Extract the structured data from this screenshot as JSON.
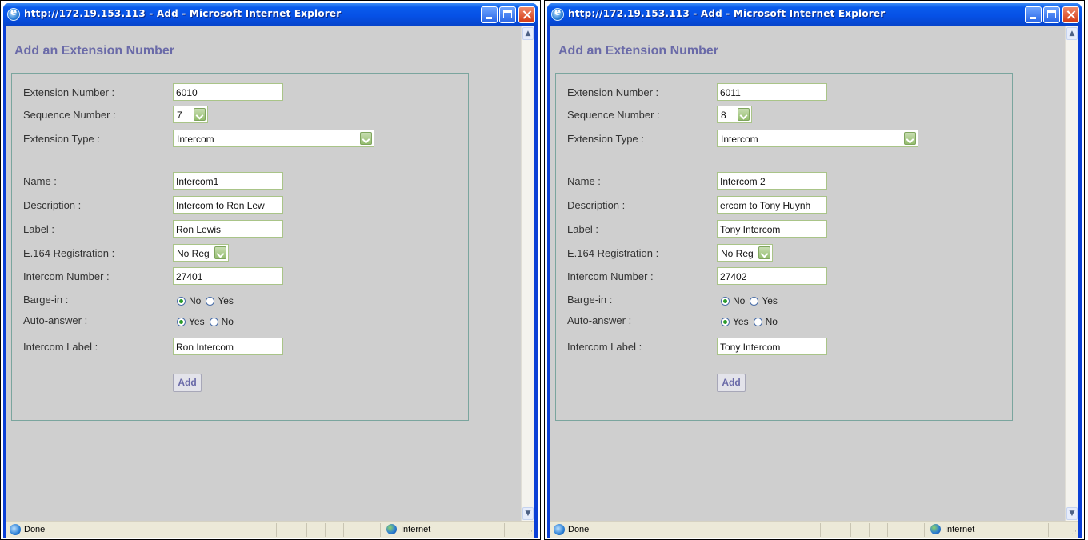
{
  "windows": [
    {
      "title": "http://172.19.153.113 - Add - Microsoft Internet Explorer",
      "page_title": "Add an Extension Number",
      "fields": {
        "extension_number": {
          "label": "Extension Number :",
          "value": "6010"
        },
        "sequence_number": {
          "label": "Sequence Number :",
          "value": "7"
        },
        "extension_type": {
          "label": "Extension Type :",
          "value": "Intercom"
        },
        "name": {
          "label": "Name :",
          "value": "Intercom1"
        },
        "description": {
          "label": "Description :",
          "value": "Intercom to Ron Lew"
        },
        "label": {
          "label": "Label :",
          "value": "Ron Lewis"
        },
        "e164_registration": {
          "label": "E.164 Registration :",
          "value": "No Reg"
        },
        "intercom_number": {
          "label": "Intercom Number :",
          "value": "27401"
        },
        "barge_in": {
          "label": "Barge-in :",
          "option1": "No",
          "option2": "Yes",
          "selected": "No"
        },
        "auto_answer": {
          "label": "Auto-answer :",
          "option1": "Yes",
          "option2": "No",
          "selected": "Yes"
        },
        "intercom_label": {
          "label": "Intercom Label :",
          "value": "Ron Intercom"
        }
      },
      "add_button": "Add",
      "status": {
        "text": "Done",
        "zone": "Internet"
      }
    },
    {
      "title": "http://172.19.153.113 - Add - Microsoft Internet Explorer",
      "page_title": "Add an Extension Number",
      "fields": {
        "extension_number": {
          "label": "Extension Number :",
          "value": "6011"
        },
        "sequence_number": {
          "label": "Sequence Number :",
          "value": "8"
        },
        "extension_type": {
          "label": "Extension Type :",
          "value": "Intercom"
        },
        "name": {
          "label": "Name :",
          "value": "Intercom 2"
        },
        "description": {
          "label": "Description :",
          "value": "ercom to Tony Huynh"
        },
        "label": {
          "label": "Label :",
          "value": "Tony Intercom"
        },
        "e164_registration": {
          "label": "E.164 Registration :",
          "value": "No Reg"
        },
        "intercom_number": {
          "label": "Intercom Number :",
          "value": "27402"
        },
        "barge_in": {
          "label": "Barge-in :",
          "option1": "No",
          "option2": "Yes",
          "selected": "No"
        },
        "auto_answer": {
          "label": "Auto-answer :",
          "option1": "Yes",
          "option2": "No",
          "selected": "Yes"
        },
        "intercom_label": {
          "label": "Intercom Label :",
          "value": "Tony Intercom"
        }
      },
      "add_button": "Add",
      "status": {
        "text": "Done",
        "zone": "Internet"
      }
    }
  ]
}
